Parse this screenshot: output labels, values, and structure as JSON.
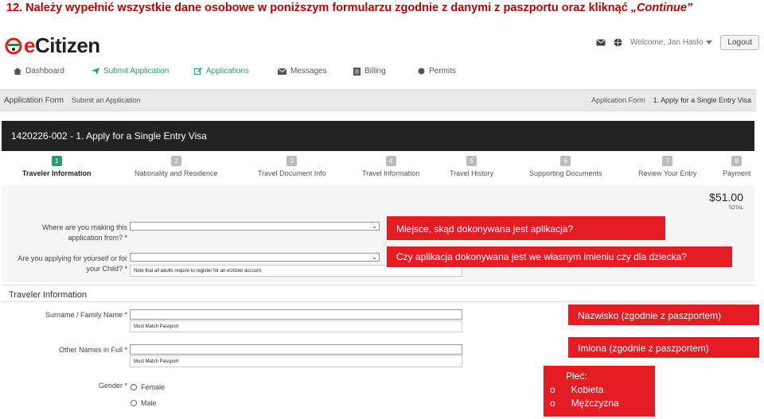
{
  "instruction": {
    "prefix": "12.  Należy wypełnić wszystkie dane osobowe w poniższym formularzu zgodnie z danymi z paszportu oraz kliknąć ",
    "continue": "„Continue”"
  },
  "header": {
    "logo_e": "e",
    "logo_rest": "Citizen",
    "welcome": "Welcome, Jan Haslo",
    "logout": "Logout"
  },
  "nav": [
    {
      "label": "Dashboard",
      "icon": "home-icon"
    },
    {
      "label": "Submit Application",
      "icon": "send-icon"
    },
    {
      "label": "Applications",
      "icon": "edit-icon"
    },
    {
      "label": "Messages",
      "icon": "envelope-icon"
    },
    {
      "label": "Billing",
      "icon": "billing-icon"
    },
    {
      "label": "Permits",
      "icon": "permit-icon"
    }
  ],
  "breadcrumb": {
    "title": "Application Form",
    "subtitle": "Submit an Application",
    "crumb1": "Application Form",
    "crumb2": "1. Apply for a Single Entry Visa"
  },
  "form_header": "1420226-002 - 1. Apply for a Single Entry Visa",
  "steps": [
    {
      "num": "1",
      "label": "Traveler Information"
    },
    {
      "num": "2",
      "label": "Nationality and Residence"
    },
    {
      "num": "3",
      "label": "Travel Document Info"
    },
    {
      "num": "4",
      "label": "Travel Information"
    },
    {
      "num": "5",
      "label": "Travel History"
    },
    {
      "num": "6",
      "label": "Supporting Documents"
    },
    {
      "num": "7",
      "label": "Review Your Entry"
    },
    {
      "num": "8",
      "label": "Payment"
    }
  ],
  "price": {
    "amount": "$51.00",
    "total": "TOTAL"
  },
  "fields": {
    "where_label": "Where are you making this application from?",
    "for_self_label": "Are you applying for yourself or for your Child?",
    "adult_note": "Note that all adults require to register for an ecitizen account.",
    "section_title": "Traveler Information",
    "surname_label": "Surname / Family Name",
    "surname_placeholder": "Must Match Passport",
    "other_names_label": "Other Names in Full",
    "other_names_placeholder": "Must Match Passport",
    "gender_label": "Gender",
    "female": "Female",
    "male": "Male"
  },
  "callouts": {
    "c1": "Miejsce, skąd dokonywana jest aplikacja?",
    "c2": "Czy aplikacja dokonywana jest we własnym imieniu czy dla dziecka?",
    "c3": "Nazwisko (zgodnie z paszportem)",
    "c4": "Imiona (zgodnie z paszportem)",
    "c5_title": "Płeć:",
    "c5_opt1": "Kobieta",
    "c5_opt2": "Mężczyzna",
    "bullet": "o"
  },
  "colors": {
    "accent": "#2a9a70",
    "callout": "#e41c23",
    "instruction": "#c00000"
  }
}
